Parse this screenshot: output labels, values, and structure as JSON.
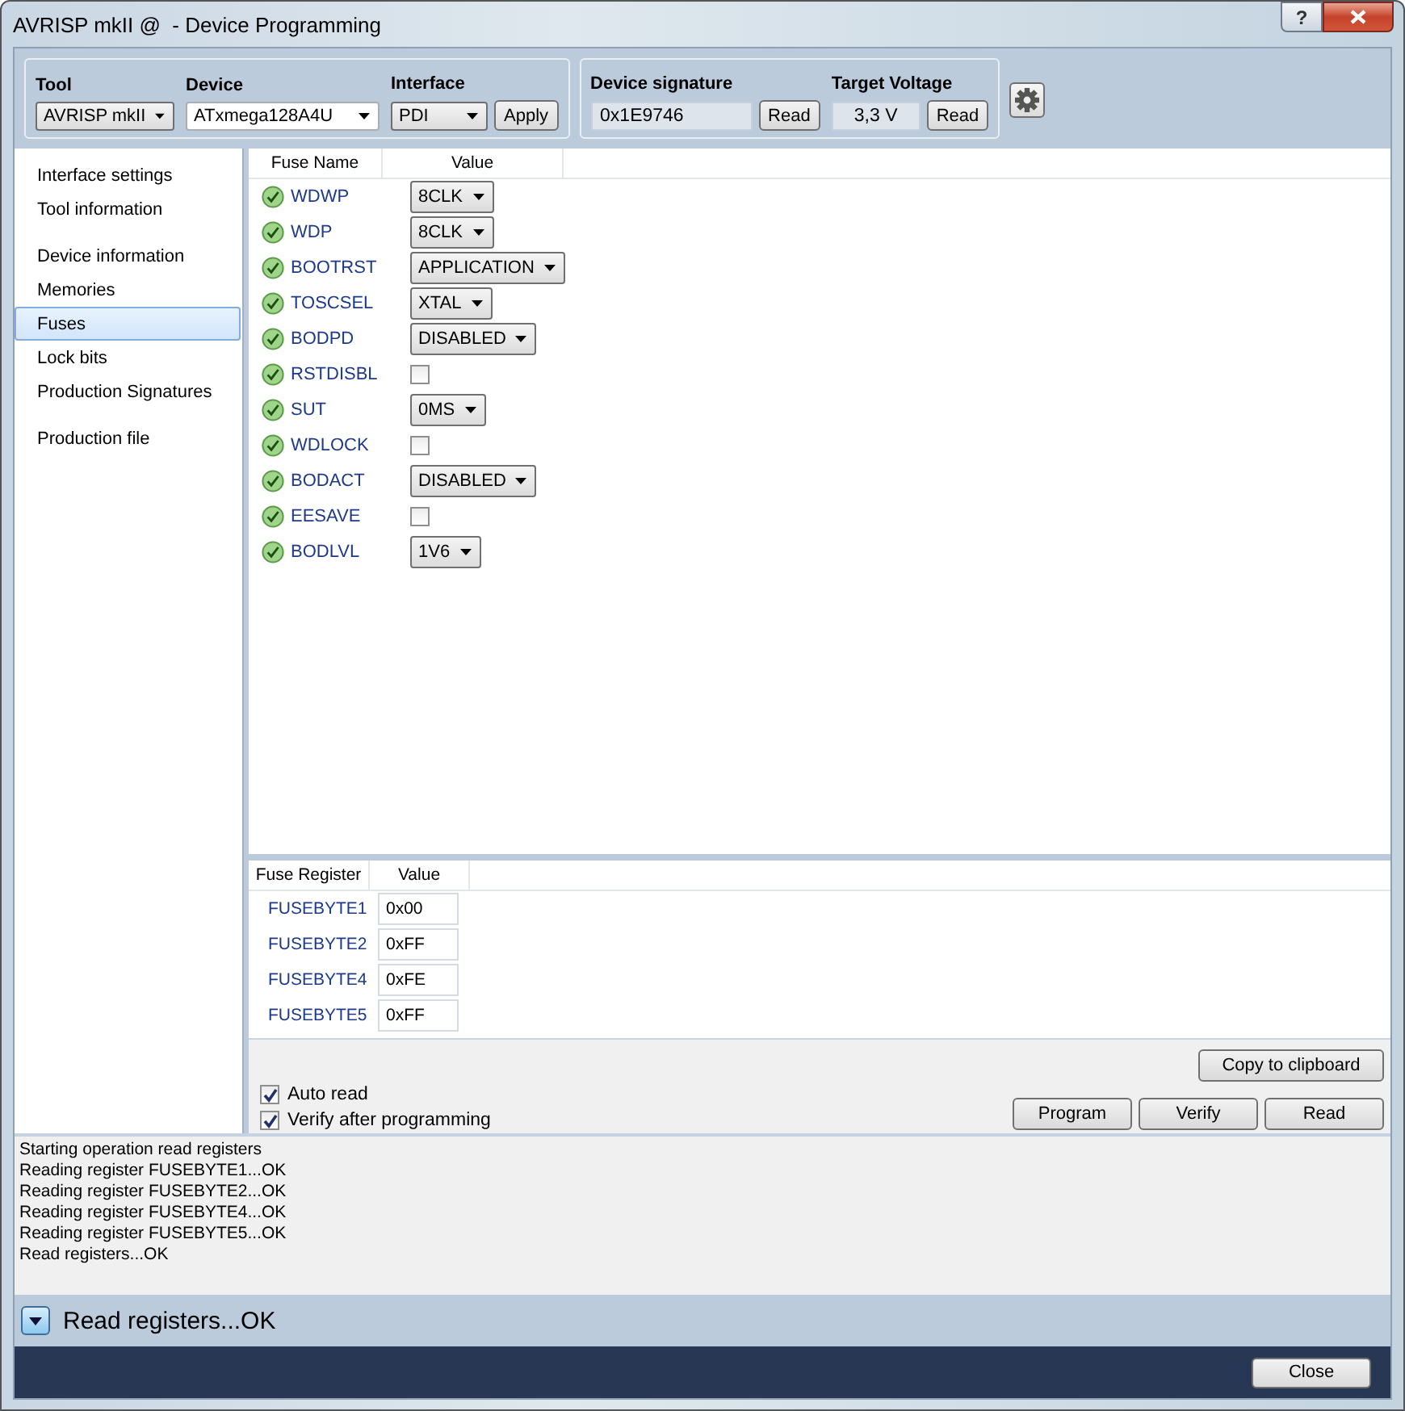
{
  "window": {
    "title": "AVRISP mkII @  - Device Programming",
    "help": "?"
  },
  "toolbar": {
    "tool": {
      "label": "Tool",
      "value": "AVRISP mkII"
    },
    "device": {
      "label": "Device",
      "value": "ATxmega128A4U"
    },
    "interface": {
      "label": "Interface",
      "value": "PDI"
    },
    "apply": "Apply",
    "signature": {
      "label": "Device signature",
      "value": "0x1E9746",
      "button": "Read"
    },
    "voltage": {
      "label": "Target Voltage",
      "value": "3,3 V",
      "button": "Read"
    }
  },
  "sidebar": {
    "groups": [
      [
        {
          "label": "Interface settings",
          "selected": false
        },
        {
          "label": "Tool information",
          "selected": false
        }
      ],
      [
        {
          "label": "Device information",
          "selected": false
        },
        {
          "label": "Memories",
          "selected": false
        },
        {
          "label": "Fuses",
          "selected": true
        },
        {
          "label": "Lock bits",
          "selected": false
        },
        {
          "label": "Production Signatures",
          "selected": false
        }
      ],
      [
        {
          "label": "Production file",
          "selected": false
        }
      ]
    ]
  },
  "fuses": {
    "columns": [
      "Fuse Name",
      "Value"
    ],
    "rows": [
      {
        "name": "WDWP",
        "kind": "dropdown",
        "value": "8CLK"
      },
      {
        "name": "WDP",
        "kind": "dropdown",
        "value": "8CLK"
      },
      {
        "name": "BOOTRST",
        "kind": "dropdown",
        "value": "APPLICATION"
      },
      {
        "name": "TOSCSEL",
        "kind": "dropdown",
        "value": "XTAL"
      },
      {
        "name": "BODPD",
        "kind": "dropdown",
        "value": "DISABLED"
      },
      {
        "name": "RSTDISBL",
        "kind": "checkbox",
        "checked": false
      },
      {
        "name": "SUT",
        "kind": "dropdown",
        "value": "0MS"
      },
      {
        "name": "WDLOCK",
        "kind": "checkbox",
        "checked": false
      },
      {
        "name": "BODACT",
        "kind": "dropdown",
        "value": "DISABLED"
      },
      {
        "name": "EESAVE",
        "kind": "checkbox",
        "checked": false
      },
      {
        "name": "BODLVL",
        "kind": "dropdown",
        "value": "1V6"
      }
    ]
  },
  "registers": {
    "columns": [
      "Fuse Register",
      "Value"
    ],
    "rows": [
      {
        "name": "FUSEBYTE1",
        "value": "0x00"
      },
      {
        "name": "FUSEBYTE2",
        "value": "0xFF"
      },
      {
        "name": "FUSEBYTE4",
        "value": "0xFE"
      },
      {
        "name": "FUSEBYTE5",
        "value": "0xFF"
      }
    ]
  },
  "options": [
    {
      "label": "Auto read",
      "checked": true
    },
    {
      "label": "Verify after programming",
      "checked": true
    }
  ],
  "buttons": {
    "copy": "Copy to clipboard",
    "actions": [
      "Program",
      "Verify",
      "Read"
    ]
  },
  "log": [
    "Starting operation read registers",
    "Reading register FUSEBYTE1...OK",
    "Reading register FUSEBYTE2...OK",
    "Reading register FUSEBYTE4...OK",
    "Reading register FUSEBYTE5...OK",
    "Read registers...OK"
  ],
  "status": "Read registers...OK",
  "close": "Close"
}
